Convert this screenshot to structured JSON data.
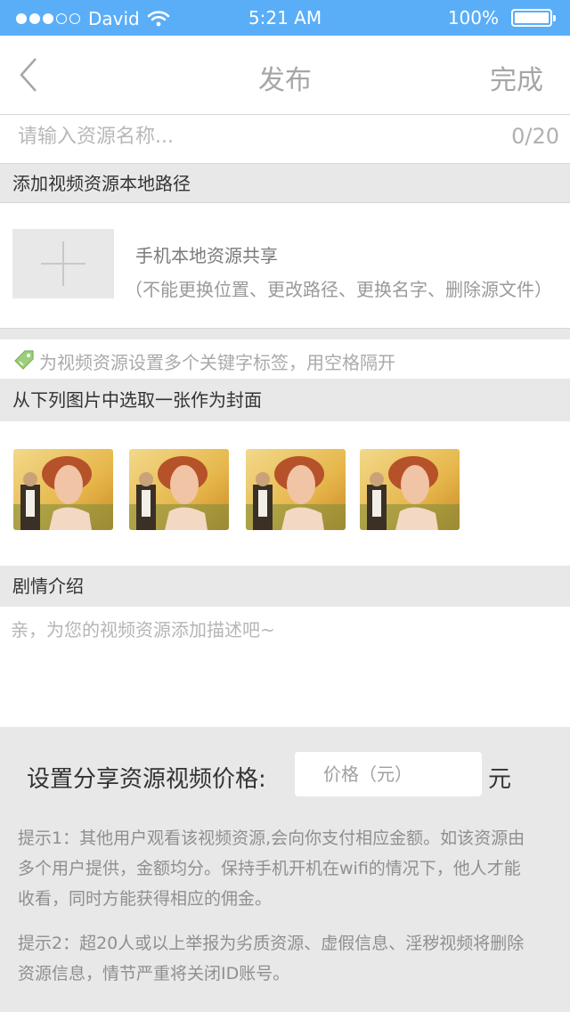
{
  "status_bar": {
    "carrier": "David",
    "time": "5:21 AM",
    "battery": "100%"
  },
  "nav": {
    "title": "发布",
    "done_label": "完成"
  },
  "resource_name": {
    "placeholder": "请输入资源名称...",
    "counter": "0/20"
  },
  "local_path": {
    "header": "添加视频资源本地路径",
    "share_title": "手机本地资源共享",
    "share_note": "（不能更换位置、更改路径、更换名字、删除源文件）"
  },
  "tags": {
    "hint": "为视频资源设置多个关键字标签，用空格隔开"
  },
  "cover": {
    "header": "从下列图片中选取一张作为封面"
  },
  "plot": {
    "header": "剧情介绍",
    "placeholder": "亲，为您的视频资源添加描述吧~"
  },
  "price": {
    "label": "设置分享资源视频价格:",
    "placeholder": "价格（元）",
    "unit": "元"
  },
  "tips": {
    "tip1": "提示1：其他用户观看该视频资源,会向你支付相应金额。如该资源由多个用户提供，金额均分。保持手机开机在wifi的情况下，他人才能收看，同时方能获得相应的佣金。",
    "tip2": "提示2：超20人或以上举报为劣质资源、虚假信息、淫秽视频将删除资源信息，情节严重将关闭ID账号。"
  },
  "colors": {
    "status_bar": "#5aaef7",
    "section_bg": "#e8e8e8"
  }
}
